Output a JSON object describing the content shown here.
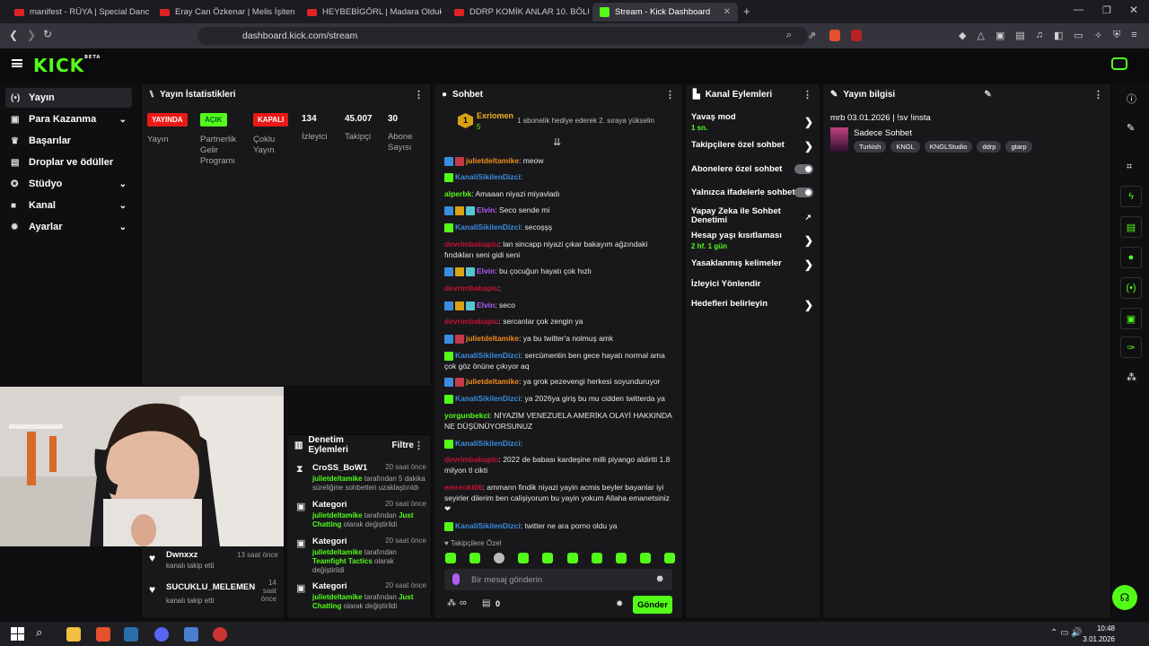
{
  "browser": {
    "tabs": [
      {
        "label": "manifest - RÜYA | Special Dance",
        "icon": "youtube-icon"
      },
      {
        "label": "Eray Can Özkenar | Melis İşiten ile Za",
        "icon": "youtube-icon"
      },
      {
        "label": "HEYBEBİGÖRL | Madara Olduk #627",
        "icon": "youtube-icon"
      },
      {
        "label": "DDRP KOMİK ANLAR 10. BÖLÜM VE",
        "icon": "youtube-icon"
      },
      {
        "label": "Stream - Kick Dashboard",
        "icon": "kick-icon"
      }
    ],
    "url": "dashboard.kick.com/stream"
  },
  "brand": {
    "logo": "KICK",
    "beta": "BETA",
    "accent": "#53fc18"
  },
  "sidebar": {
    "items": [
      {
        "label": "Yayın",
        "icon": "broadcast-icon"
      },
      {
        "label": "Para Kazanma",
        "icon": "money-icon"
      },
      {
        "label": "Başarılar",
        "icon": "trophy-icon"
      },
      {
        "label": "Droplar ve ödüller",
        "icon": "gift-icon"
      },
      {
        "label": "Stüdyo",
        "icon": "studio-icon"
      },
      {
        "label": "Kanal",
        "icon": "channel-icon"
      },
      {
        "label": "Ayarlar",
        "icon": "gear-icon"
      }
    ]
  },
  "stats": {
    "title": "Yayın İstatistikleri",
    "badges": [
      {
        "value": "YAYINDA",
        "label": "Yayın",
        "color": "#e91916"
      },
      {
        "value": "AÇIK",
        "label": "Partnerlik Gelir Programı",
        "color": "#53fc18"
      },
      {
        "value": "KAPALI",
        "label": "Çoklu Yayın",
        "color": "#e91916"
      }
    ],
    "numbers": [
      {
        "value": "134",
        "label": "İzleyici"
      },
      {
        "value": "45.007",
        "label": "Takipçi"
      },
      {
        "value": "30",
        "label": "Abone Sayısı"
      }
    ]
  },
  "chat": {
    "title": "Sohbet",
    "pinned_user": "Exriomen",
    "pinned_count": "5",
    "pinned_text": "1 abonelik hediye ederek 2. sıraya yükselin",
    "messages": [
      {
        "user": "julietdeltamike",
        "color": "#f08c1c",
        "badges": [
          "sub",
          "rb"
        ],
        "text": ": meow"
      },
      {
        "user": "KanaliSikilenDizci",
        "color": "#3a8dde",
        "badges": [
          "gb"
        ],
        "text": ":"
      },
      {
        "user": "alperbk",
        "color": "#53fc18",
        "badges": [],
        "text": ": Amaaan niyazi miyavladı"
      },
      {
        "user": "Elvin",
        "color": "#b05cf5",
        "badges": [
          "sub",
          "crown",
          "ng"
        ],
        "text": ": Seco sende mi"
      },
      {
        "user": "KanaliSikilenDizci",
        "color": "#3a8dde",
        "badges": [
          "gb"
        ],
        "text": ": secoşşş"
      },
      {
        "user": "devrimbabapiu",
        "color": "#c41230",
        "badges": [],
        "text": ": lan sincapp niyazi çıkar bakayım ağzındaki fındıkları seni gidi seni"
      },
      {
        "user": "Elvin",
        "color": "#b05cf5",
        "badges": [
          "sub",
          "crown",
          "ng"
        ],
        "text": ": bu çocuğun hayatı çok hızlı"
      },
      {
        "user": "devrimbabapiu",
        "color": "#c41230",
        "badges": [],
        "text": ":"
      },
      {
        "user": "Elvin",
        "color": "#b05cf5",
        "badges": [
          "sub",
          "crown",
          "ng"
        ],
        "text": ": seco"
      },
      {
        "user": "devrimbabapiu",
        "color": "#c41230",
        "badges": [],
        "text": ": sercanlar çok zengin ya"
      },
      {
        "user": "julietdeltamike",
        "color": "#f08c1c",
        "badges": [
          "sub",
          "rb"
        ],
        "text": ": ya bu twitter'a nolmuş amk"
      },
      {
        "user": "KanaliSikilenDizci",
        "color": "#3a8dde",
        "badges": [
          "gb"
        ],
        "text": ": sercümentin ben gece hayatı normal ama çok göz önüne çıkıyor aq"
      },
      {
        "user": "julietdeltamike",
        "color": "#f08c1c",
        "badges": [
          "sub",
          "rb"
        ],
        "text": ": ya grok pezevengi herkesi soyunduruyor"
      },
      {
        "user": "KanaliSikilenDizci",
        "color": "#3a8dde",
        "badges": [
          "gb"
        ],
        "text": ": ya 2026ya giriş bu mu cidden twitterda ya"
      },
      {
        "user": "yorgunbekci",
        "color": "#53fc18",
        "badges": [],
        "text": ": NİYAZİM VENEZUELA AMERİKA OLAYİ HAKKINDA NE DÜŞÜNÜYORSUNUZ"
      },
      {
        "user": "KanaliSikilenDizci",
        "color": "#3a8dde",
        "badges": [
          "gb"
        ],
        "text": ":"
      },
      {
        "user": "devrimbabapiu",
        "color": "#c41230",
        "badges": [],
        "text": ": 2022 de babası kardeşine milli piyango aldirtti 1.8 milyon tl cikti"
      },
      {
        "user": "emreokt06",
        "color": "#c41230",
        "badges": [],
        "text": ": ammann findik niyazi yayin acmis beyler bayanlar iyi seyirler dilerim ben calişiyorum bu yayin yokum Allaha emanetsiniz ❤"
      },
      {
        "user": "KanaliSikilenDizci",
        "color": "#3a8dde",
        "badges": [
          "gb"
        ],
        "text": ": twitter ne ara porno oldu ya"
      }
    ],
    "followers_only": "Takipçilere Özel",
    "input_placeholder": "Bir mesaj gönderin",
    "points": "∞",
    "gift_count": "0",
    "send_label": "Gönder"
  },
  "moderation": {
    "title": "Denetim Eylemleri",
    "filter": "Filtre",
    "items": [
      {
        "title": "CroSS_BoW1",
        "time": "20 saat önce",
        "icon": "hourglass-icon",
        "actor": "julietdeltamike",
        "desc": " tarafından 5 dakika süreliğine sohbetten uzaklaştırıldı",
        "tail": ""
      },
      {
        "title": "Kategori",
        "time": "20 saat önce",
        "icon": "category-icon",
        "actor": "julietdeltamike",
        "desc": " tarafından ",
        "tag": "Just Chatting",
        "tail": " olarak değiştirildi"
      },
      {
        "title": "Kategori",
        "time": "20 saat önce",
        "icon": "category-icon",
        "actor": "julietdeltamike",
        "desc": " tarafından ",
        "tag": "Teamfight Tactics",
        "tail": " olarak değiştirildi"
      },
      {
        "title": "Kategori",
        "time": "20 saat önce",
        "icon": "category-icon",
        "actor": "julietdeltamike",
        "desc": " tarafından ",
        "tag": "Just Chatting",
        "tail": " olarak değiştirildi"
      }
    ]
  },
  "followers": [
    {
      "name": "Dwnxxz",
      "time": "13 saat önce",
      "desc": "kanalı takip etti"
    },
    {
      "name": "SUCUKLU_MELEMEN",
      "time": "14 saat önce",
      "desc": "kanalı takip etti"
    }
  ],
  "channel_actions": {
    "title": "Kanal Eylemleri",
    "items": [
      {
        "label": "Yavaş mod",
        "sub": "1 sn.",
        "control": "arrow"
      },
      {
        "label": "Takipçilere özel sohbet",
        "sub": "",
        "control": "arrow"
      },
      {
        "label": "Abonelere özel sohbet",
        "sub": "",
        "control": "toggle"
      },
      {
        "label": "Yalnızca ifadelerle sohbet",
        "sub": "",
        "control": "toggle"
      },
      {
        "label": "Yapay Zeka ile Sohbet Denetimi",
        "sub": "",
        "control": "external"
      },
      {
        "label": "Hesap yaşı kısıtlaması",
        "sub": "2 hf. 1 gün",
        "control": "arrow"
      },
      {
        "label": "Yasaklanmış kelimeler",
        "sub": "",
        "control": "arrow"
      },
      {
        "label": "İzleyici Yönlendir",
        "sub": "",
        "control": "none"
      },
      {
        "label": "Hedefleri belirleyin",
        "sub": "",
        "control": "arrow"
      }
    ]
  },
  "stream_info": {
    "title": "Yayın bilgisi",
    "stream_title": "mrb 03.01.2026 | !sv !insta",
    "category": "Sadece Sohbet",
    "tags": [
      "Turkish",
      "KNGL",
      "KNGLStudio",
      "ddrp",
      "gtarp"
    ]
  },
  "taskbar": {
    "time": "10:48",
    "date": "3.01.2026"
  }
}
